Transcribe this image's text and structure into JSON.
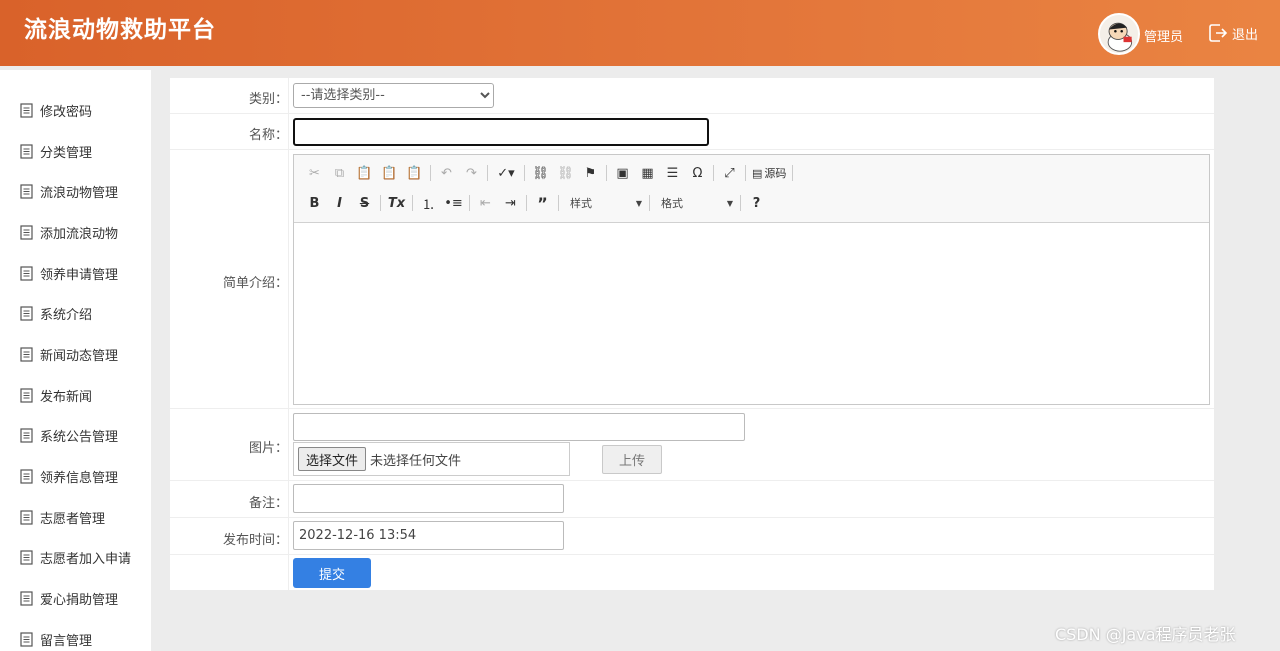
{
  "header": {
    "title": "流浪动物救助平台",
    "user_name": "管理员",
    "logout_label": "退出"
  },
  "sidebar": {
    "items": [
      {
        "label": "修改密码"
      },
      {
        "label": "分类管理"
      },
      {
        "label": "流浪动物管理"
      },
      {
        "label": "添加流浪动物"
      },
      {
        "label": "领养申请管理"
      },
      {
        "label": "系统介绍"
      },
      {
        "label": "新闻动态管理"
      },
      {
        "label": "发布新闻"
      },
      {
        "label": "系统公告管理"
      },
      {
        "label": "领养信息管理"
      },
      {
        "label": "志愿者管理"
      },
      {
        "label": "志愿者加入申请"
      },
      {
        "label": "爱心捐助管理"
      },
      {
        "label": "留言管理"
      }
    ]
  },
  "form": {
    "category_label": "类别",
    "category_selected": "--请选择类别--",
    "name_label": "名称",
    "name_value": "",
    "intro_label": "简单介绍",
    "editor": {
      "style_combo": "样式",
      "format_combo": "格式",
      "source_label": "源码",
      "help_label": "?"
    },
    "image_label": "图片",
    "image_path_value": "",
    "choose_file_label": "选择文件",
    "no_file_text": "未选择任何文件",
    "upload_label": "上传",
    "remark_label": "备注",
    "remark_value": "",
    "publish_time_label": "发布时间",
    "publish_time_value": "2022-12-16 13:54",
    "submit_label": "提交"
  },
  "watermark": "CSDN @Java程序员老张",
  "colors": {
    "header_start": "#d9622a",
    "header_end": "#ea8442",
    "submit": "#3480e3"
  }
}
